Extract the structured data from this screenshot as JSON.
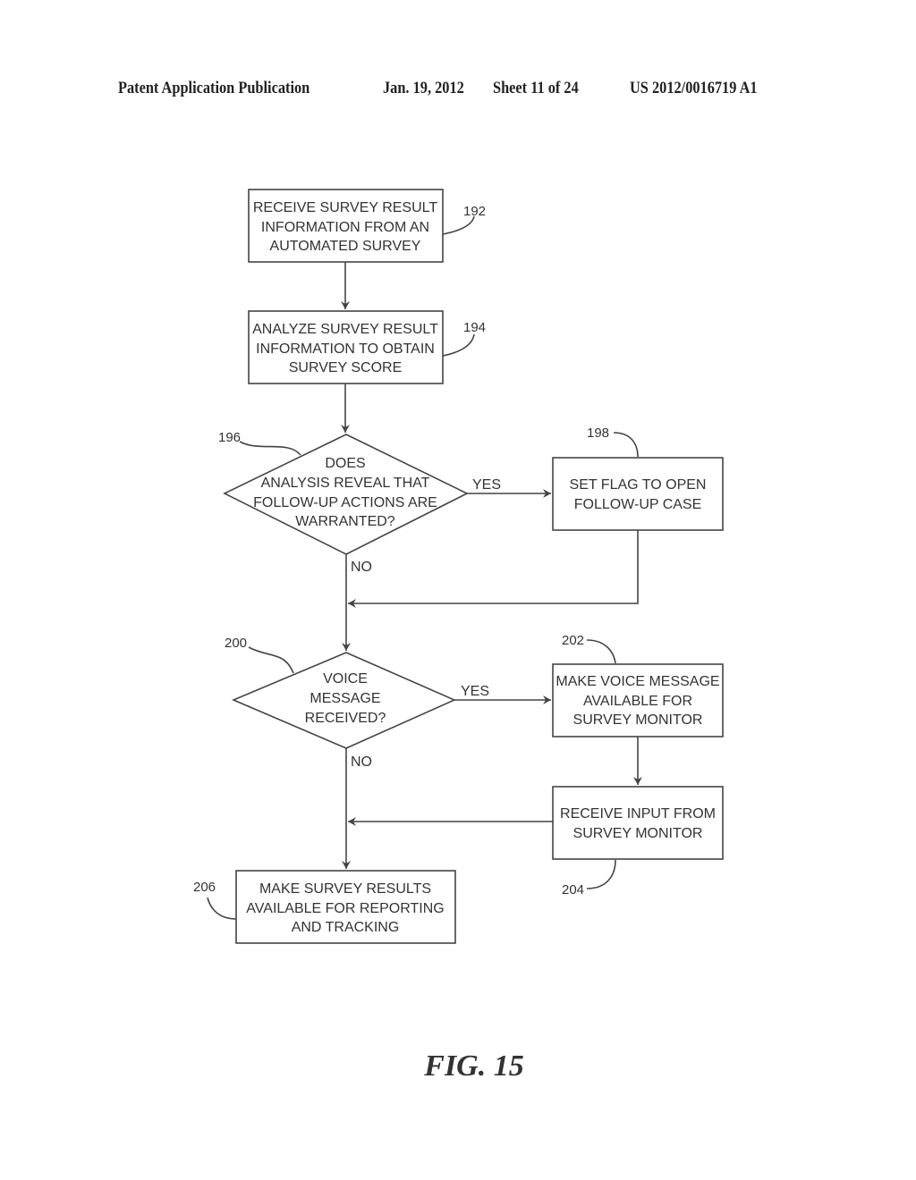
{
  "header": {
    "publication": "Patent Application Publication",
    "date": "Jan. 19, 2012",
    "sheet": "Sheet 11 of 24",
    "number": "US 2012/0016719 A1"
  },
  "flowchart": {
    "nodes": [
      {
        "id": "192",
        "type": "process",
        "lines": [
          "RECEIVE SURVEY RESULT",
          "INFORMATION FROM AN",
          "AUTOMATED SURVEY"
        ]
      },
      {
        "id": "194",
        "type": "process",
        "lines": [
          "ANALYZE SURVEY RESULT",
          "INFORMATION TO OBTAIN",
          "SURVEY SCORE"
        ]
      },
      {
        "id": "196",
        "type": "decision",
        "lines": [
          "DOES",
          "ANALYSIS REVEAL THAT",
          "FOLLOW-UP ACTIONS ARE",
          "WARRANTED?"
        ]
      },
      {
        "id": "198",
        "type": "process",
        "lines": [
          "SET FLAG TO OPEN",
          "FOLLOW-UP CASE"
        ]
      },
      {
        "id": "200",
        "type": "decision",
        "lines": [
          "VOICE",
          "MESSAGE",
          "RECEIVED?"
        ]
      },
      {
        "id": "202",
        "type": "process",
        "lines": [
          "MAKE VOICE MESSAGE",
          "AVAILABLE FOR",
          "SURVEY MONITOR"
        ]
      },
      {
        "id": "204",
        "type": "process",
        "lines": [
          "RECEIVE INPUT FROM",
          "SURVEY MONITOR"
        ]
      },
      {
        "id": "206",
        "type": "process",
        "lines": [
          "MAKE SURVEY RESULTS",
          "AVAILABLE FOR REPORTING",
          "AND TRACKING"
        ]
      }
    ],
    "edges": [
      {
        "from": "192",
        "to": "194",
        "label": ""
      },
      {
        "from": "194",
        "to": "196",
        "label": ""
      },
      {
        "from": "196",
        "to": "198",
        "label": "YES"
      },
      {
        "from": "196",
        "to": "200",
        "label": "NO"
      },
      {
        "from": "198",
        "to": "200",
        "label": ""
      },
      {
        "from": "200",
        "to": "202",
        "label": "YES"
      },
      {
        "from": "200",
        "to": "206",
        "label": "NO"
      },
      {
        "from": "202",
        "to": "204",
        "label": ""
      },
      {
        "from": "204",
        "to": "206",
        "label": ""
      }
    ],
    "labels": {
      "yes": "YES",
      "no": "NO"
    }
  },
  "figure_caption": "FIG. 15"
}
